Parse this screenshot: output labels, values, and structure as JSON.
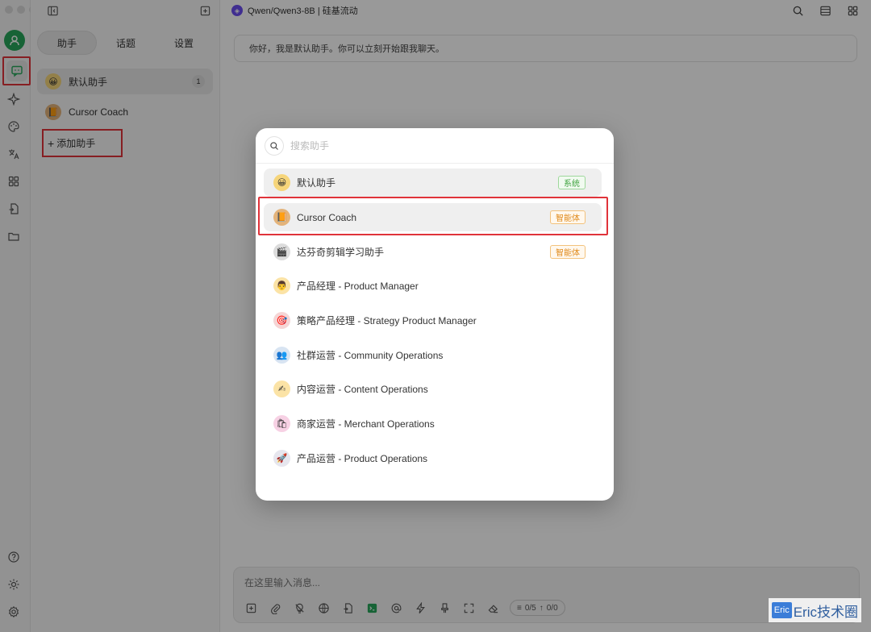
{
  "sidebar": {
    "tabs": [
      {
        "label": "助手",
        "active": true
      },
      {
        "label": "话题",
        "active": false
      },
      {
        "label": "设置",
        "active": false
      }
    ],
    "assistants": [
      {
        "name": "默认助手",
        "icon": "smiley-face-icon",
        "count": "1"
      },
      {
        "name": "Cursor Coach",
        "icon": "book-icon"
      }
    ],
    "add_label": "添加助手"
  },
  "header": {
    "model_label": "Qwen/Qwen3-8B | 硅基流动"
  },
  "main": {
    "welcome_text": "你好，我是默认助手。你可以立刻开始跟我聊天。",
    "composer_placeholder": "在这里输入消息...",
    "token_counter": "0/5",
    "token_counter_2": "0/0"
  },
  "modal": {
    "search_placeholder": "搜索助手",
    "items": [
      {
        "name": "默认助手",
        "icon": "smiley-face-icon",
        "tag": "系统",
        "tag_type": "system"
      },
      {
        "name": "Cursor Coach",
        "icon": "book-icon",
        "tag": "智能体",
        "tag_type": "agent"
      },
      {
        "name": "达芬奇剪辑学习助手",
        "icon": "clapperboard-icon",
        "tag": "智能体",
        "tag_type": "agent"
      },
      {
        "name": "产品经理 - Product Manager",
        "icon": "person-face-icon"
      },
      {
        "name": "策略产品经理 - Strategy Product Manager",
        "icon": "dart-target-icon"
      },
      {
        "name": "社群运营 - Community Operations",
        "icon": "people-icon"
      },
      {
        "name": "内容运营 - Content Operations",
        "icon": "writing-hand-icon"
      },
      {
        "name": "商家运营 - Merchant Operations",
        "icon": "shopping-bag-icon"
      },
      {
        "name": "产品运营 - Product Operations",
        "icon": "rocket-icon"
      }
    ]
  },
  "watermark": {
    "box_text": "Eric",
    "text": "Eric技术圈"
  },
  "colors": {
    "accent_green": "#27a55a",
    "highlight_red": "#e0333a",
    "system_tag": "#3ea33e",
    "agent_tag": "#e08a1b"
  }
}
